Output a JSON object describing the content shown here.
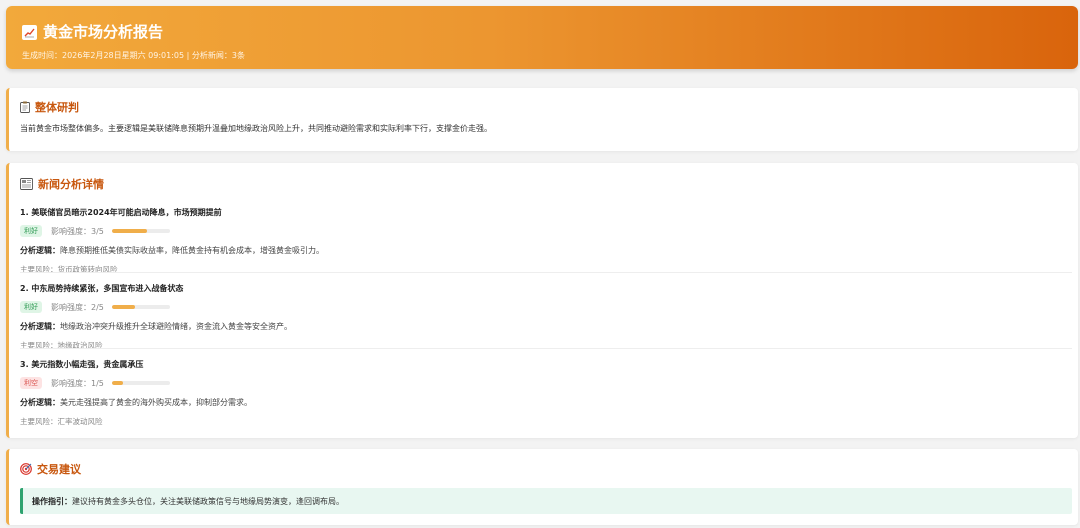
{
  "header": {
    "title": "黄金市场分析报告",
    "meta": "生成时间：2026年2月28日星期六 09:01:05 | 分析新闻：3条",
    "accent": "#e88a24"
  },
  "summary": {
    "title": "整体研判",
    "text": "当前黄金市场整体偏多。主要逻辑是美联储降息预期升温叠加地缘政治风险上升，共同推动避险需求和实际利率下行，支撑金价走强。"
  },
  "news": {
    "title": "新闻分析详情",
    "impact_prefix": "影响强度：",
    "logic_prefix": "分析逻辑：",
    "risk_prefix": "主要风险：",
    "items": [
      {
        "title": "1. 美联储官员暗示2024年可能启动降息，市场预期提前",
        "tag": "利好",
        "tag_type": "good",
        "impact": "3/5",
        "impact_value": 3,
        "impact_max": 5,
        "logic": "降息预期推低美债实际收益率，降低黄金持有机会成本，增强黄金吸引力。",
        "risk": "货币政策转向风险"
      },
      {
        "title": "2. 中东局势持续紧张，多国宣布进入战备状态",
        "tag": "利好",
        "tag_type": "good",
        "impact": "2/5",
        "impact_value": 2,
        "impact_max": 5,
        "logic": "地缘政治冲突升级推升全球避险情绪，资金流入黄金等安全资产。",
        "risk": "地缘政治风险"
      },
      {
        "title": "3. 美元指数小幅走强，贵金属承压",
        "tag": "利空",
        "tag_type": "bad",
        "impact": "1/5",
        "impact_value": 1,
        "impact_max": 5,
        "logic": "美元走强提高了黄金的海外购买成本，抑制部分需求。",
        "risk": "汇率波动风险"
      }
    ]
  },
  "advice": {
    "title": "交易建议",
    "label": "操作指引：",
    "text": "建议持有黄金多头仓位，关注美联储政策信号与地缘局势演变，逢回调布局。"
  }
}
